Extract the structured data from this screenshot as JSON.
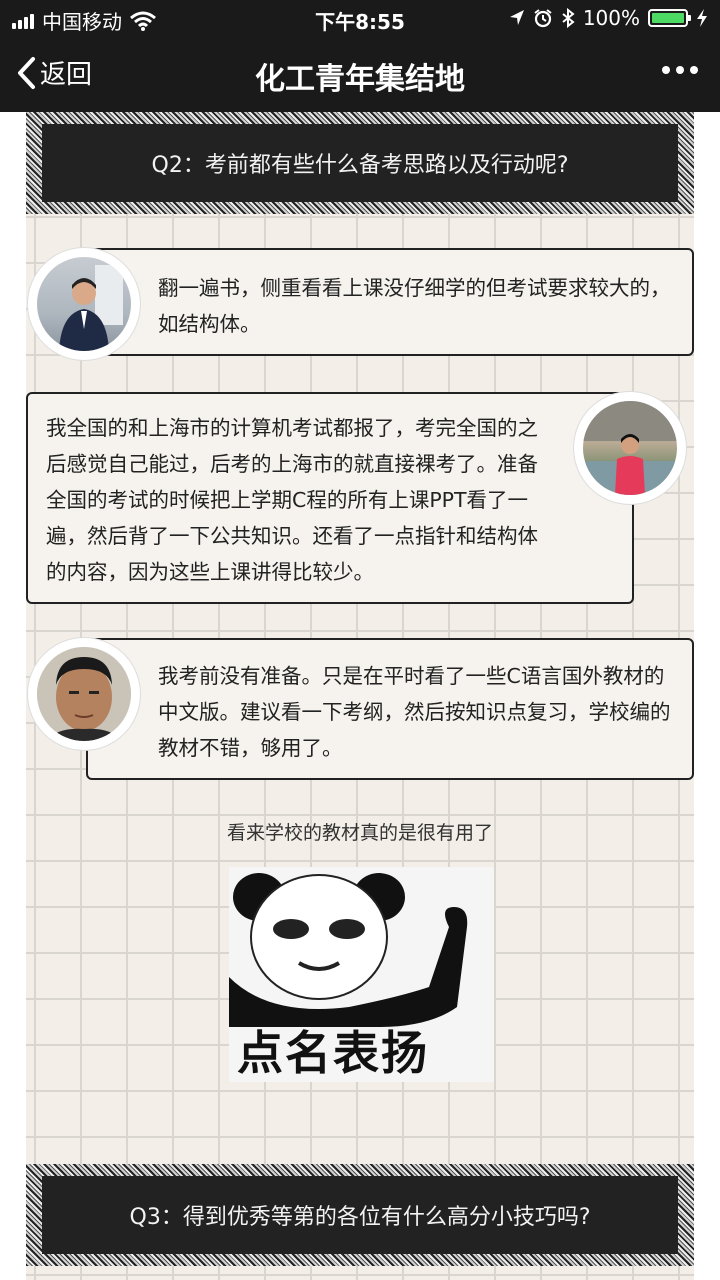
{
  "status_bar": {
    "carrier": "中国移动",
    "time": "下午8:55",
    "battery": "100%"
  },
  "nav": {
    "back_label": "返回",
    "title": "化工青年集结地"
  },
  "article": {
    "q2": "Q2：考前都有些什么备考思路以及行动呢?",
    "answers": [
      {
        "text": "翻一遍书，侧重看看上课没仔细学的但考试要求较大的，如结构体。"
      },
      {
        "text": "我全国的和上海市的计算机考试都报了，考完全国的之后感觉自己能过，后考的上海市的就直接裸考了。准备全国的考试的时候把上学期C程的所有上课PPT看了一遍，然后背了一下公共知识。还看了一点指针和结构体的内容，因为这些上课讲得比较少。"
      },
      {
        "text": "我考前没有准备。只是在平时看了一些C语言国外教材的中文版。建议看一下考纲，然后按知识点复习，学校编的教材不错，够用了。"
      }
    ],
    "caption": "看来学校的教材真的是很有用了",
    "sticker_text": "点名表扬",
    "q3": "Q3：得到优秀等第的各位有什么高分小技巧吗?"
  },
  "colors": {
    "bar_bg": "#1a1a1a",
    "paper": "#f3efe8",
    "grid": "#d9d5cf",
    "battery": "#4cd964"
  }
}
